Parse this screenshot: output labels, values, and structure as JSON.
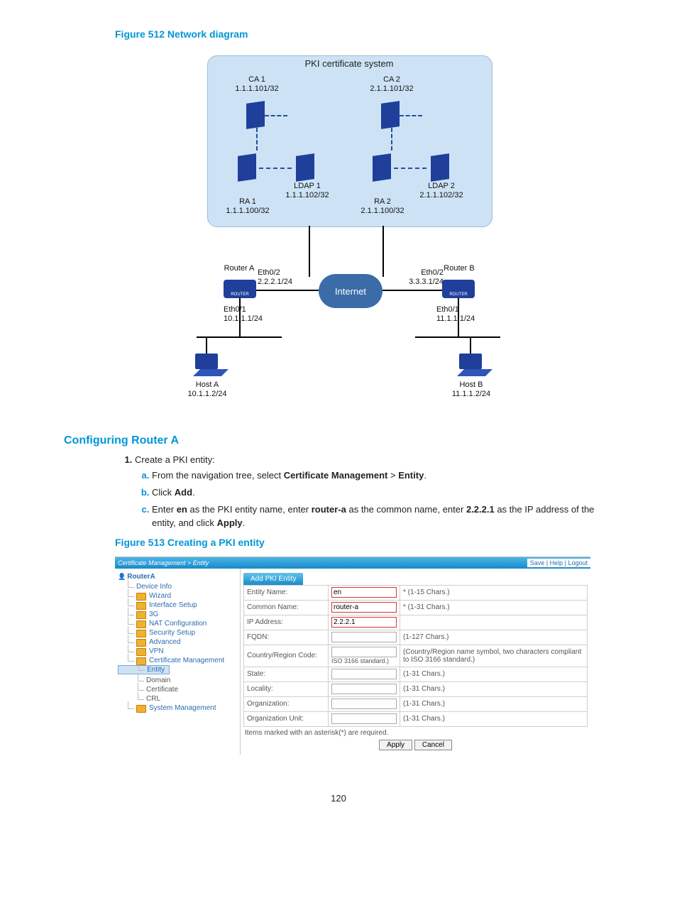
{
  "figure512_title": "Figure 512 Network diagram",
  "diagram": {
    "pki_system": "PKI certificate system",
    "ca1": {
      "name": "CA 1",
      "addr": "1.1.1.101/32"
    },
    "ca2": {
      "name": "CA 2",
      "addr": "2.1.1.101/32"
    },
    "ra1": {
      "name": "RA 1",
      "addr": "1.1.1.100/32"
    },
    "ra2": {
      "name": "RA 2",
      "addr": "2.1.1.100/32"
    },
    "ldap1": {
      "name": "LDAP 1",
      "addr": "1.1.1.102/32"
    },
    "ldap2": {
      "name": "LDAP 2",
      "addr": "2.1.1.102/32"
    },
    "routera": {
      "name": "Router A",
      "iface_out": "Eth0/2",
      "out_addr": "2.2.2.1/24",
      "iface_in": "Eth0/1",
      "in_addr": "10.1.1.1/24"
    },
    "routerb": {
      "name": "Router B",
      "iface_out": "Eth0/2",
      "out_addr": "3.3.3.1/24",
      "iface_in": "Eth0/1",
      "in_addr": "11.1.1.1/24"
    },
    "internet": "Internet",
    "hosta": {
      "name": "Host A",
      "addr": "10.1.1.2/24"
    },
    "hostb": {
      "name": "Host B",
      "addr": "11.1.1.2/24"
    }
  },
  "section_heading": "Configuring Router A",
  "steps": {
    "s1": "Create a PKI entity:",
    "s1a_pre": "From the navigation tree, select ",
    "s1a_b1": "Certificate Management",
    "s1a_gt": " > ",
    "s1a_b2": "Entity",
    "s1a_post": ".",
    "s1b_pre": "Click ",
    "s1b_b": "Add",
    "s1b_post": ".",
    "s1c_pre": "Enter ",
    "s1c_b1": "en",
    "s1c_mid1": " as the PKI entity name, enter ",
    "s1c_b2": "router-a",
    "s1c_mid2": " as the common name, enter ",
    "s1c_b3": "2.2.2.1",
    "s1c_mid3": " as the IP address of the entity, and click ",
    "s1c_b4": "Apply",
    "s1c_post": "."
  },
  "figure513_title": "Figure 513 Creating a PKI entity",
  "ui": {
    "breadcrumb": "Certificate Management > Entity",
    "toplinks": "Save | Help | Logout",
    "device_root": "RouterA",
    "tree": {
      "device_info": "Device Info",
      "wizard": "Wizard",
      "interface_setup": "Interface Setup",
      "g3": "3G",
      "nat": "NAT Configuration",
      "security": "Security Setup",
      "advanced": "Advanced",
      "vpn": "VPN",
      "cert_mgmt": "Certificate Management",
      "entity": "Entity",
      "domain": "Domain",
      "certificate": "Certificate",
      "crl": "CRL",
      "sysmgmt": "System Management"
    },
    "tab": "Add PKI Entity",
    "form": {
      "entity_name_lbl": "Entity Name:",
      "entity_name_val": "en",
      "entity_name_hint": "* (1-15 Chars.)",
      "common_name_lbl": "Common Name:",
      "common_name_val": "router-a",
      "common_name_hint": "* (1-31 Chars.)",
      "ip_lbl": "IP Address:",
      "ip_val": "2.2.2.1",
      "fqdn_lbl": "FQDN:",
      "fqdn_hint": "(1-127 Chars.)",
      "country_lbl": "Country/Region Code:",
      "country_hint": "(Country/Region name symbol, two characters compliant to ISO 3166 standard.)",
      "country_sub": "ISO 3166 standard.)",
      "state_lbl": "State:",
      "state_hint": "(1-31 Chars.)",
      "locality_lbl": "Locality:",
      "locality_hint": "(1-31 Chars.)",
      "org_lbl": "Organization:",
      "org_hint": "(1-31 Chars.)",
      "ou_lbl": "Organization Unit:",
      "ou_hint": "(1-31 Chars.)",
      "note": "Items marked with an asterisk(*) are required.",
      "apply": "Apply",
      "cancel": "Cancel"
    }
  },
  "page_number": "120"
}
